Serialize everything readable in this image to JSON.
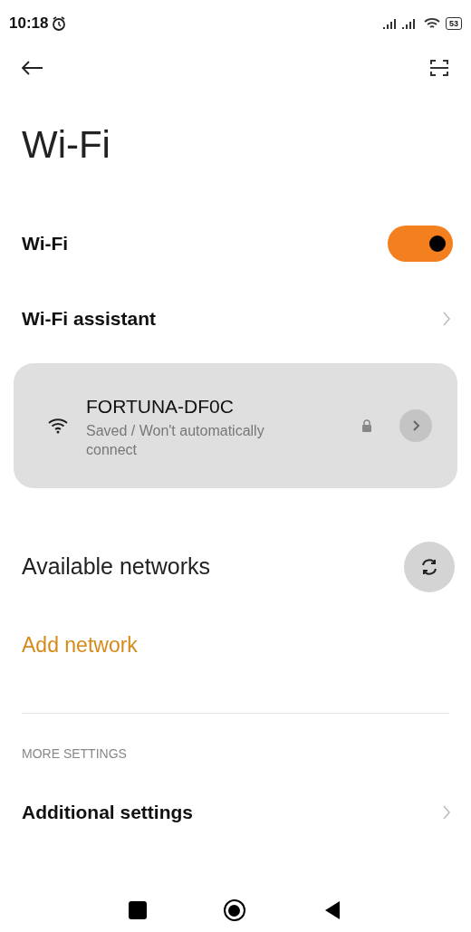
{
  "status_bar": {
    "time": "10:18",
    "battery": "53"
  },
  "title": "Wi-Fi",
  "wifi_toggle": {
    "label": "Wi-Fi",
    "on": true
  },
  "assistant": {
    "label": "Wi-Fi assistant"
  },
  "saved_network": {
    "name": "FORTUNA-DF0C",
    "status": "Saved / Won't automatically connect",
    "locked": true
  },
  "available_networks": {
    "label": "Available networks"
  },
  "add_network": {
    "label": "Add network"
  },
  "more_settings": {
    "header": "MORE SETTINGS",
    "items": [
      {
        "label": "Additional settings"
      }
    ]
  }
}
